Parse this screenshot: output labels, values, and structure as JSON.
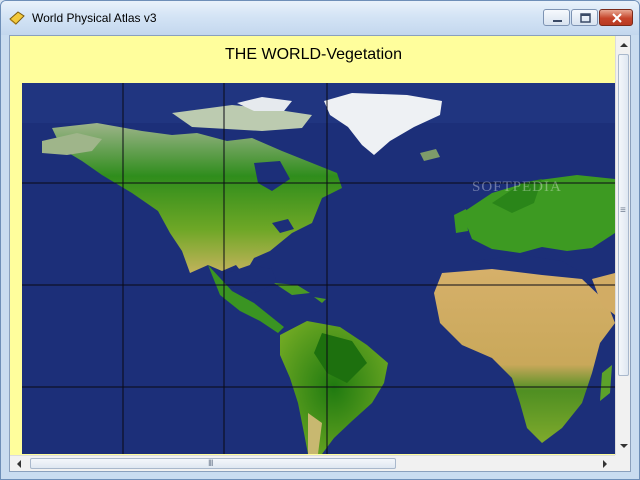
{
  "window": {
    "title": "World Physical Atlas v3"
  },
  "map": {
    "title": "THE WORLD-Vegetation",
    "watermark": "SOFTPEDIA",
    "colors": {
      "ocean": "#1a2f7a",
      "vegetation": "#2e8b1a",
      "desert": "#d8b46a",
      "ice": "#f2f4f6",
      "background": "#fffe9c",
      "grid": "#0a0a14"
    }
  },
  "scrollbars": {
    "horizontal_grip": "III",
    "vertical_grip": "≡"
  },
  "icons": {
    "app": "atlas-icon",
    "minimize": "minimize-icon",
    "maximize": "maximize-icon",
    "close": "close-icon"
  }
}
